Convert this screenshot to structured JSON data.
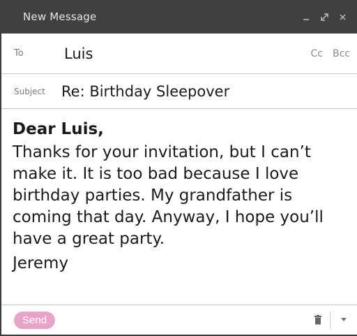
{
  "window": {
    "title": "New Message"
  },
  "titlebar_controls": {
    "minimize_icon": "minimize-icon",
    "popout_icon": "popout-icon",
    "close_icon": "close-icon"
  },
  "fields": {
    "to_label": "To",
    "to_value": "Luis",
    "cc_label": "Cc",
    "bcc_label": "Bcc",
    "subject_label": "Subject",
    "subject_value": "Re: Birthday Sleepover"
  },
  "message": {
    "greeting": "Dear Luis,",
    "body": "Thanks for your invitation, but I can’t make it. It is too bad because I love birthday parties.  My grandfather is coming that day. Anyway, I hope you’ll have a great party.",
    "signature": "Jeremy"
  },
  "footer": {
    "send_label": "Send",
    "trash_icon": "trash-icon",
    "more_icon": "chevron-down-icon"
  },
  "colors": {
    "titlebar_bg": "#404040",
    "send_bg": "#e8a3c9",
    "label_gray": "#7a7a7a"
  }
}
